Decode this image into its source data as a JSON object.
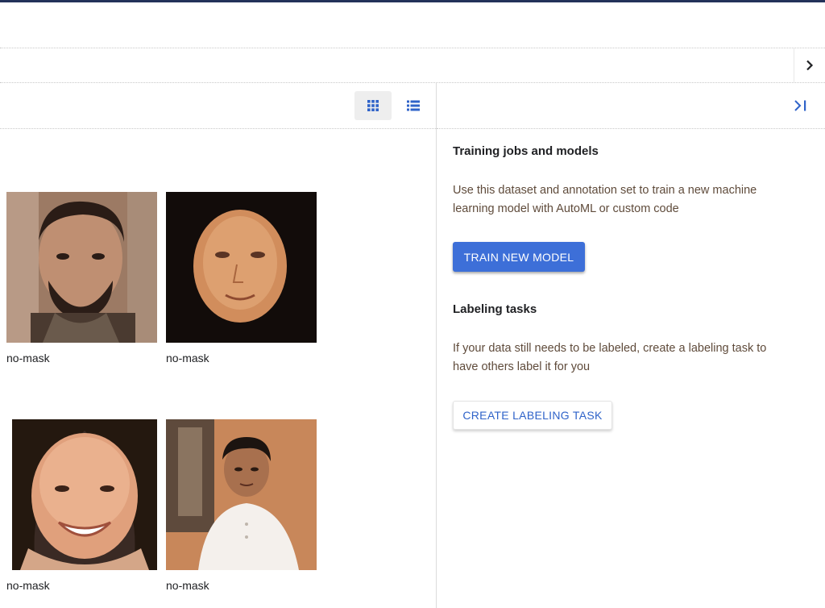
{
  "tabs_bar": {
    "scroll_icon": "chevron-right-icon"
  },
  "toolbar": {
    "grid_view_icon": "grid-view-icon",
    "list_view_icon": "list-view-icon",
    "active_view": "grid"
  },
  "gallery": {
    "items": [
      {
        "label": "no-mask",
        "image": "face-photo-man-beard"
      },
      {
        "label": "no-mask",
        "image": "face-render-woman"
      },
      {
        "label": "no-mask",
        "image": "face-photo-woman-smiling"
      },
      {
        "label": "no-mask",
        "image": "face-photo-young-man"
      }
    ]
  },
  "side_panel": {
    "collapse_icon": "collapse-panel-icon",
    "training": {
      "title": "Training jobs and models",
      "description_line1": "Use this dataset and annotation set to train a new machine",
      "description_line2": "learning model with AutoML or custom code",
      "button_label": "TRAIN NEW MODEL"
    },
    "labeling": {
      "title": "Labeling tasks",
      "description_line1": "If your data still needs to be labeled, create a labeling task to",
      "description_line2": "have others label it for you",
      "button_label": "CREATE LABELING TASK"
    }
  },
  "colors": {
    "accent": "#3d6fd8",
    "accent_text": "#2f63c9",
    "body_text": "#5f4b3b"
  }
}
